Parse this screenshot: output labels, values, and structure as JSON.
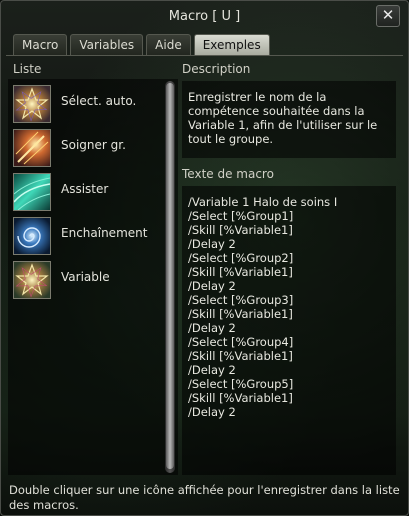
{
  "window": {
    "title": "Macro [ U ]",
    "close_label": "✕"
  },
  "tabs": [
    {
      "label": "Macro",
      "active": false
    },
    {
      "label": "Variables",
      "active": false
    },
    {
      "label": "Aide",
      "active": false
    },
    {
      "label": "Exemples",
      "active": true
    }
  ],
  "list": {
    "header": "Liste",
    "items": [
      {
        "label": "Sélect. auto.",
        "icon": "star-burst-icon"
      },
      {
        "label": "Soigner gr.",
        "icon": "heal-ray-icon"
      },
      {
        "label": "Assister",
        "icon": "wave-icon"
      },
      {
        "label": "Enchaînement",
        "icon": "swirl-icon"
      },
      {
        "label": "Variable",
        "icon": "star-burst-icon"
      }
    ]
  },
  "description": {
    "header": "Description",
    "text": "Enregistrer le nom de la compétence souhaitée dans la Variable 1, afin de l'utiliser sur le tout le groupe."
  },
  "macro_text": {
    "header": "Texte de macro",
    "lines": [
      "/Variable 1 Halo de soins I",
      "/Select [%Group1]",
      "/Skill [%Variable1]",
      "/Delay 2",
      "/Select [%Group2]",
      "/Skill [%Variable1]",
      "/Delay 2",
      "/Select [%Group3]",
      "/Skill [%Variable1]",
      "/Delay 2",
      "/Select [%Group4]",
      "/Skill [%Variable1]",
      "/Delay 2",
      "/Select [%Group5]",
      "/Skill [%Variable1]",
      "/Delay 2"
    ]
  },
  "footer": "Double cliquer sur une icône affichée pour l'enregistrer dans la liste des macros."
}
